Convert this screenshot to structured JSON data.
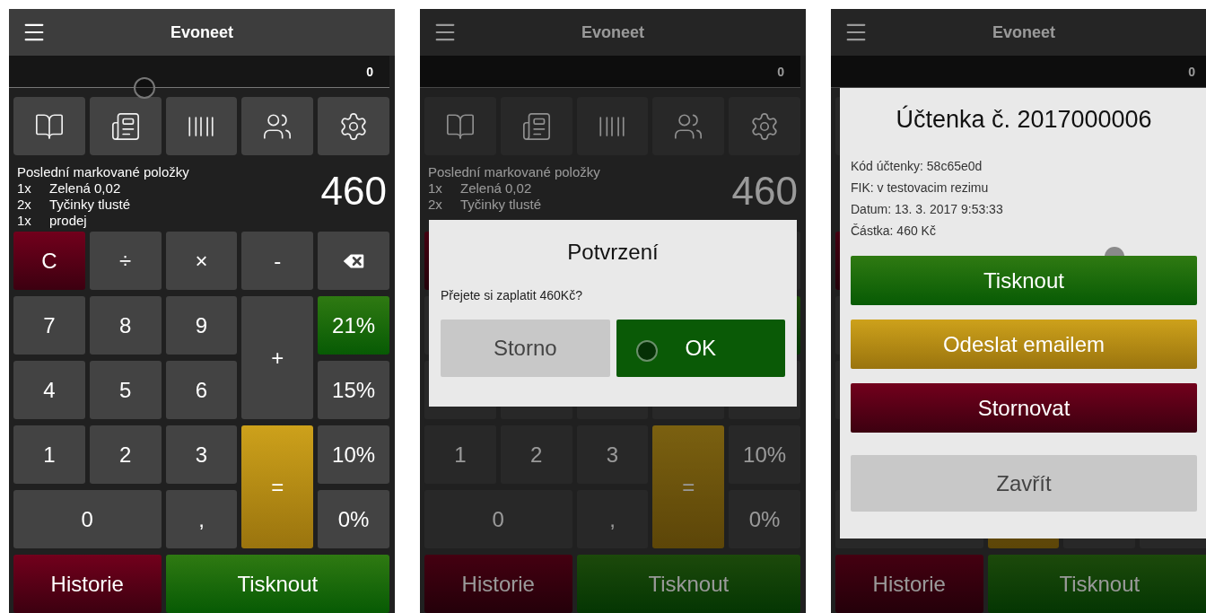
{
  "screens": [
    {
      "dimmed": false,
      "header": {
        "title": "Evoneet"
      },
      "display": {
        "value": "0",
        "touched": true
      },
      "toolbar": [
        {
          "kind": "book"
        },
        {
          "kind": "list"
        },
        {
          "kind": "barcode"
        },
        {
          "kind": "people"
        },
        {
          "kind": "settings"
        }
      ],
      "recent": {
        "title": "Poslední markované položky",
        "items": [
          {
            "qty": "1x",
            "name": "Zelená 0,02"
          },
          {
            "qty": "2x",
            "name": "Tyčinky tlusté"
          },
          {
            "qty": "1x",
            "name": "prodej"
          }
        ]
      },
      "total": "460",
      "keys": [
        {
          "kind": "clear",
          "label": "C"
        },
        {
          "kind": "key",
          "label": "÷"
        },
        {
          "kind": "key",
          "label": "×"
        },
        {
          "kind": "key",
          "label": "-"
        },
        {
          "kind": "backspace"
        },
        {
          "kind": "key",
          "label": "7"
        },
        {
          "kind": "key",
          "label": "8"
        },
        {
          "kind": "key",
          "label": "9"
        },
        {
          "kind": "plus",
          "label": "+"
        },
        {
          "kind": "vat",
          "label": "21%",
          "selected": true
        },
        {
          "kind": "key",
          "label": "4"
        },
        {
          "kind": "key",
          "label": "5"
        },
        {
          "kind": "key",
          "label": "6"
        },
        {
          "kind": "vat",
          "label": "15%",
          "selected": false
        },
        {
          "kind": "key",
          "label": "1"
        },
        {
          "kind": "key",
          "label": "2"
        },
        {
          "kind": "key",
          "label": "3"
        },
        {
          "kind": "equals",
          "label": "="
        },
        {
          "kind": "vat",
          "label": "10%",
          "selected": false
        },
        {
          "kind": "zero",
          "label": "0"
        },
        {
          "kind": "key",
          "label": ","
        },
        {
          "kind": "vat",
          "label": "0%",
          "selected": false
        },
        {
          "kind": "history",
          "label": "Historie"
        },
        {
          "kind": "print",
          "label": "Tisknout"
        }
      ]
    },
    {
      "dimmed": true,
      "header": {
        "title": "Evoneet"
      },
      "display": {
        "value": "0"
      },
      "toolbar": [
        {
          "kind": "book"
        },
        {
          "kind": "list"
        },
        {
          "kind": "barcode"
        },
        {
          "kind": "people"
        },
        {
          "kind": "settings"
        }
      ],
      "recent": {
        "title": "Poslední markované položky",
        "items": [
          {
            "qty": "1x",
            "name": "Zelená 0,02"
          },
          {
            "qty": "2x",
            "name": "Tyčinky tlusté"
          }
        ]
      },
      "total": "460",
      "keys": [
        {
          "kind": "clear"
        },
        {
          "kind": "covered"
        },
        {
          "kind": "covered"
        },
        {
          "kind": "covered"
        },
        {
          "kind": "key"
        },
        {
          "kind": "key"
        },
        {
          "kind": "covered"
        },
        {
          "kind": "covered"
        },
        {
          "kind": "plus"
        },
        {
          "kind": "vat",
          "selected": true
        },
        {
          "kind": "key"
        },
        {
          "kind": "key"
        },
        {
          "kind": "key"
        },
        {
          "kind": "vat",
          "selected": false
        },
        {
          "kind": "key",
          "label": "1"
        },
        {
          "kind": "key",
          "label": "2"
        },
        {
          "kind": "key",
          "label": "3"
        },
        {
          "kind": "equals",
          "label": "="
        },
        {
          "kind": "vat",
          "label": "10%",
          "selected": false
        },
        {
          "kind": "zero",
          "label": "0"
        },
        {
          "kind": "key",
          "label": ","
        },
        {
          "kind": "vat",
          "label": "0%",
          "selected": false
        },
        {
          "kind": "history",
          "label": "Historie"
        },
        {
          "kind": "print",
          "label": "Tisknout"
        }
      ],
      "dialog": {
        "kind": "confirm",
        "title": "Potvrzení",
        "message": "Přejete si zaplatit 460Kč?",
        "buttons": [
          {
            "kind": "cancel",
            "label": "Storno",
            "touched": false
          },
          {
            "kind": "ok",
            "label": "OK",
            "touched": true
          }
        ]
      }
    },
    {
      "dimmed": true,
      "header": {
        "title": "Evoneet"
      },
      "display": {
        "value": "0"
      },
      "toolbar": [
        {
          "kind": "blank"
        },
        {
          "kind": "covered"
        },
        {
          "kind": "covered"
        },
        {
          "kind": "covered"
        },
        {
          "kind": "covered"
        }
      ],
      "keys": [
        {
          "kind": "clear"
        },
        {
          "kind": "covered"
        },
        {
          "kind": "covered"
        },
        {
          "kind": "covered"
        },
        {
          "kind": "covered"
        },
        {
          "kind": "key"
        },
        {
          "kind": "covered"
        },
        {
          "kind": "covered"
        },
        {
          "kind": "covered"
        },
        {
          "kind": "covered"
        },
        {
          "kind": "key"
        },
        {
          "kind": "covered"
        },
        {
          "kind": "covered"
        },
        {
          "kind": "covered"
        },
        {
          "kind": "key"
        },
        {
          "kind": "covered"
        },
        {
          "kind": "covered"
        },
        {
          "kind": "equals"
        },
        {
          "kind": "covered"
        },
        {
          "kind": "zero"
        },
        {
          "kind": "key"
        },
        {
          "kind": "vat"
        },
        {
          "kind": "history",
          "label": "Historie"
        },
        {
          "kind": "print",
          "label": "Tisknout"
        }
      ],
      "dialog": {
        "kind": "receipt",
        "title": "Účtenka č. 2017000006",
        "touched": true,
        "lines": [
          "Kód účtenky: 58c65e0d",
          "FIK: v testovacim rezimu",
          "Datum: 13. 3. 2017 9:53:33",
          "Částka: 460 Kč"
        ],
        "buttons": [
          {
            "kind": "print",
            "label": "Tisknout",
            "touched": false
          },
          {
            "kind": "email",
            "label": "Odeslat emailem",
            "touched": false
          },
          {
            "kind": "void",
            "label": "Stornovat",
            "touched": false
          },
          {
            "kind": "close",
            "label": "Zavřít",
            "touched": false
          }
        ]
      }
    }
  ]
}
